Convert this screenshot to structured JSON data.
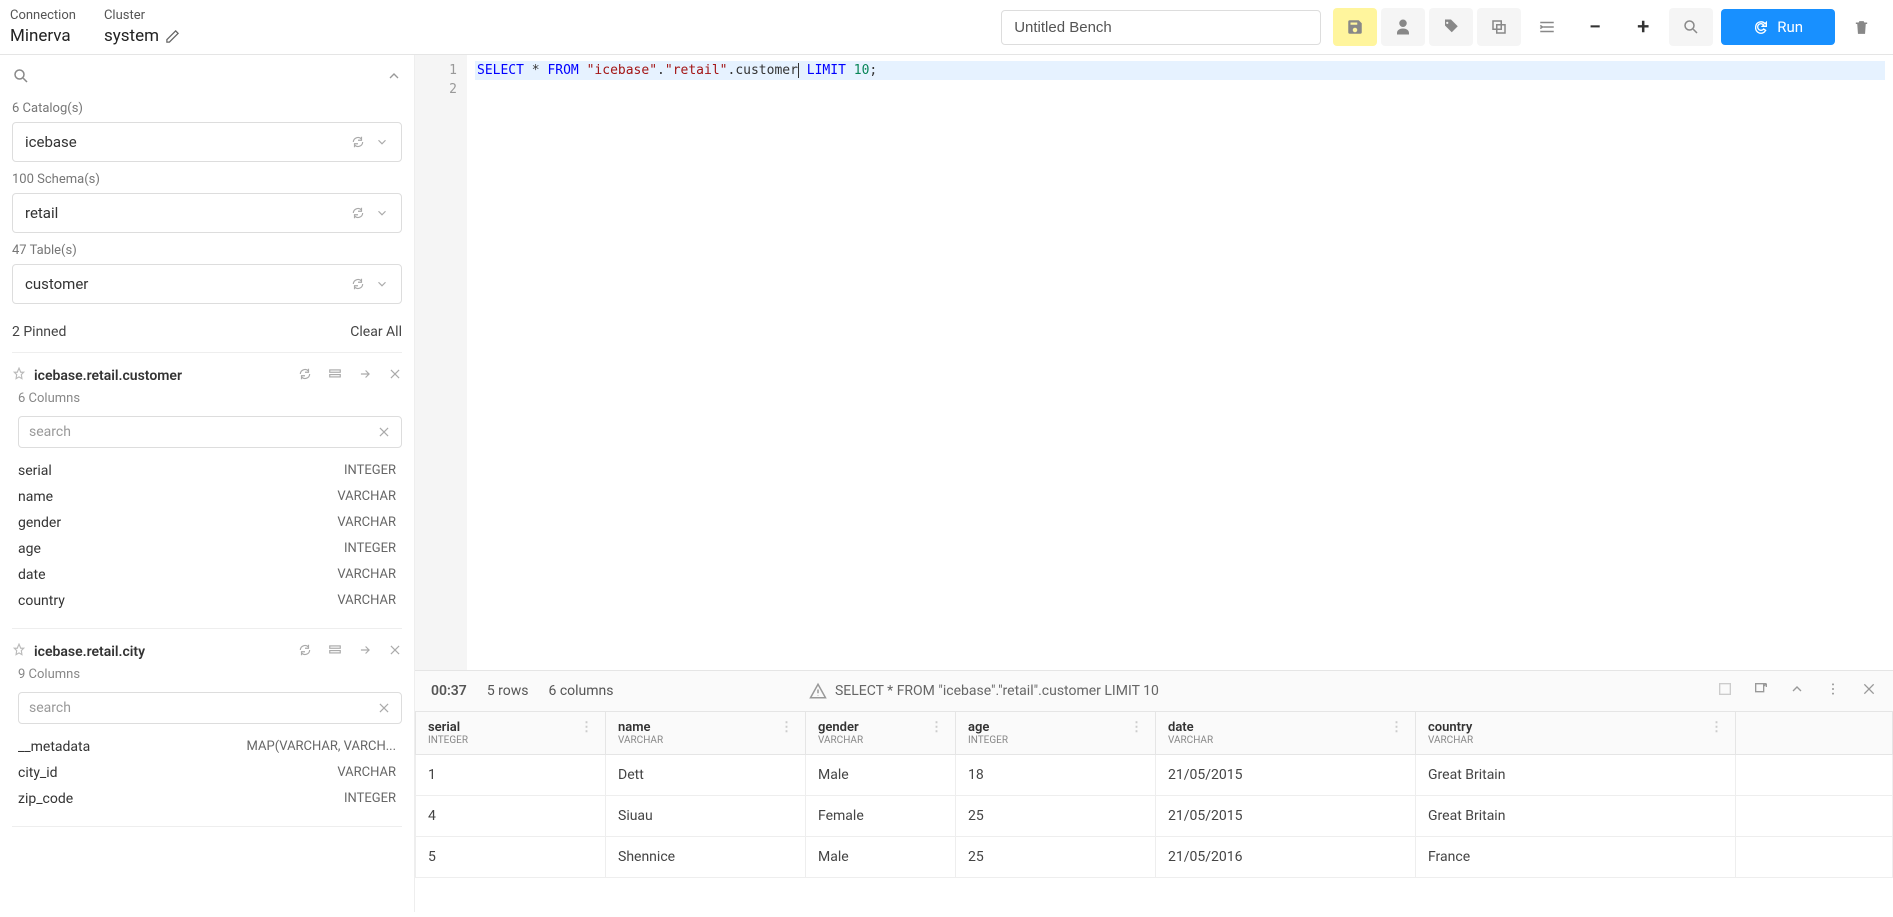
{
  "header": {
    "connection_label": "Connection",
    "connection_value": "Minerva",
    "cluster_label": "Cluster",
    "cluster_value": "system",
    "bench_title": "Untitled Bench",
    "run_label": "Run"
  },
  "sidebar": {
    "catalog_label": "6 Catalog(s)",
    "catalog_value": "icebase",
    "schema_label": "100 Schema(s)",
    "schema_value": "retail",
    "table_label": "47 Table(s)",
    "table_value": "customer",
    "pinned_label": "2 Pinned",
    "clear_all": "Clear All",
    "search_placeholder": "search",
    "pinned": [
      {
        "title": "icebase.retail.customer",
        "sub": "6 Columns",
        "columns": [
          {
            "name": "serial",
            "type": "INTEGER"
          },
          {
            "name": "name",
            "type": "VARCHAR"
          },
          {
            "name": "gender",
            "type": "VARCHAR"
          },
          {
            "name": "age",
            "type": "INTEGER"
          },
          {
            "name": "date",
            "type": "VARCHAR"
          },
          {
            "name": "country",
            "type": "VARCHAR"
          }
        ]
      },
      {
        "title": "icebase.retail.city",
        "sub": "9 Columns",
        "columns": [
          {
            "name": "__metadata",
            "type": "MAP(VARCHAR, VARCH..."
          },
          {
            "name": "city_id",
            "type": "VARCHAR"
          },
          {
            "name": "zip_code",
            "type": "INTEGER"
          }
        ]
      }
    ]
  },
  "editor": {
    "lines": [
      "1",
      "2"
    ],
    "sql_prefix": "SELECT",
    "sql_star": " * ",
    "sql_from": "FROM",
    "sql_s1": " \"icebase\"",
    "sql_dot1": ".",
    "sql_s2": "\"retail\"",
    "sql_dot2": ".customer",
    "sql_limit": " LIMIT",
    "sql_num": " 10",
    "sql_semi": ";"
  },
  "results": {
    "elapsed": "00:37",
    "rows": "5 rows",
    "cols": "6 columns",
    "query": "SELECT * FROM \"icebase\".\"retail\".customer LIMIT 10",
    "headers": [
      {
        "name": "serial",
        "type": "INTEGER"
      },
      {
        "name": "name",
        "type": "VARCHAR"
      },
      {
        "name": "gender",
        "type": "VARCHAR"
      },
      {
        "name": "age",
        "type": "INTEGER"
      },
      {
        "name": "date",
        "type": "VARCHAR"
      },
      {
        "name": "country",
        "type": "VARCHAR"
      }
    ],
    "data": [
      {
        "serial": "1",
        "name": "Dett",
        "gender": "Male",
        "age": "18",
        "date": "21/05/2015",
        "country": "Great Britain"
      },
      {
        "serial": "4",
        "name": "Siuau",
        "gender": "Female",
        "age": "25",
        "date": "21/05/2015",
        "country": "Great Britain"
      },
      {
        "serial": "5",
        "name": "Shennice",
        "gender": "Male",
        "age": "25",
        "date": "21/05/2016",
        "country": "France"
      }
    ]
  }
}
